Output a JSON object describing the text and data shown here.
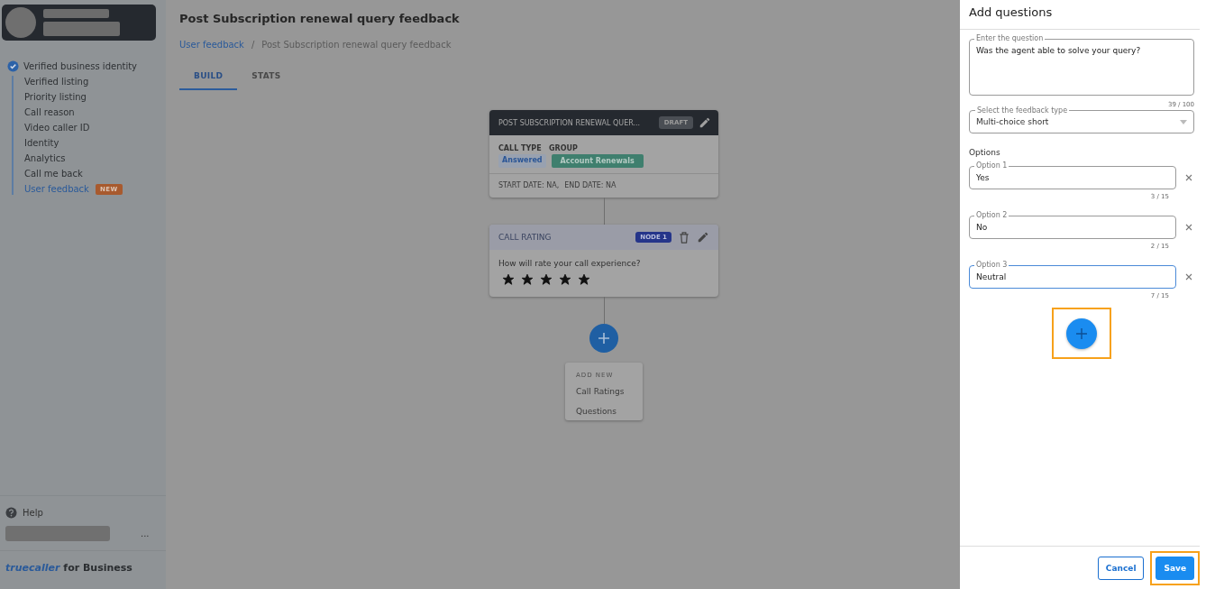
{
  "sidebar": {
    "section": {
      "label": "Verified business identity",
      "checked": true
    },
    "items": [
      {
        "label": "Verified listing",
        "selected": false
      },
      {
        "label": "Priority listing",
        "selected": false
      },
      {
        "label": "Call reason",
        "selected": false
      },
      {
        "label": "Video caller ID",
        "selected": false
      },
      {
        "label": "Identity",
        "selected": false
      },
      {
        "label": "Analytics",
        "selected": false
      },
      {
        "label": "Call me back",
        "selected": false
      },
      {
        "label": "User feedback",
        "selected": true,
        "badge": "NEW"
      }
    ],
    "help": "Help",
    "more": "...",
    "brand": {
      "logo": "truecaller",
      "suffix": "for Business"
    }
  },
  "page": {
    "title": "Post Subscription renewal query feedback",
    "breadcrumb": [
      {
        "label": "User feedback",
        "kind": "link"
      },
      {
        "label": "/",
        "kind": "separator"
      },
      {
        "label": "Post Subscription renewal query feedback",
        "kind": "current"
      }
    ],
    "tabs": [
      {
        "label": "BUILD",
        "selected": true
      },
      {
        "label": "STATS",
        "selected": false
      }
    ]
  },
  "flow": {
    "survey_card": {
      "title": "POST SUBSCRIPTION RENEWAL QUER...",
      "status": "DRAFT",
      "call_type_label": "CALL TYPE",
      "call_type": "Answered",
      "group_label": "GROUP",
      "group": "Account Renewals",
      "start_date": "START DATE: NA,",
      "end_date": "END DATE: NA"
    },
    "rating_node": {
      "title": "CALL RATING",
      "badge": "NODE 1",
      "question": "How will rate your call experience?",
      "stars": 5
    },
    "add_menu": {
      "heading": "ADD NEW",
      "items": [
        {
          "label": "Call Ratings"
        },
        {
          "label": "Questions"
        }
      ]
    }
  },
  "panel": {
    "title": "Add questions",
    "question_field": {
      "label": "Enter the question",
      "value": "Was the agent able to solve your query?",
      "counter": "39 / 100"
    },
    "type_field": {
      "label": "Select the feedback type",
      "value": "Multi-choice short"
    },
    "options_heading": "Options",
    "options": [
      {
        "label": "Option 1",
        "value": "Yes",
        "counter": "3 / 15",
        "focused": false
      },
      {
        "label": "Option 2",
        "value": "No",
        "counter": "2 / 15",
        "focused": false
      },
      {
        "label": "Option 3",
        "value": "Neutral",
        "counter": "7 / 15",
        "focused": true
      }
    ],
    "add_option": {
      "highlighted": true
    },
    "buttons": [
      {
        "label": "Cancel",
        "kind": "secondary",
        "highlighted": false
      },
      {
        "label": "Save",
        "kind": "primary",
        "highlighted": true
      }
    ]
  }
}
